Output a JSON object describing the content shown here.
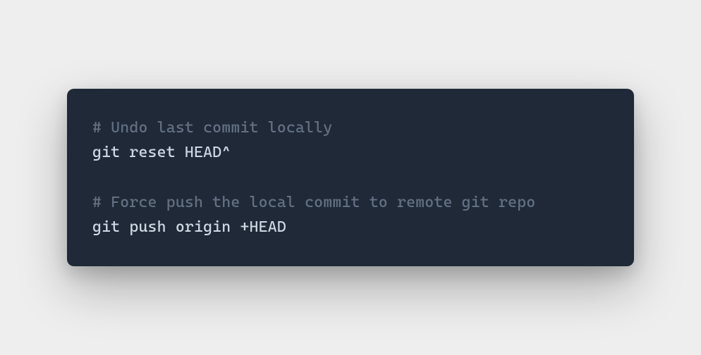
{
  "code": {
    "comment1": "# Undo last commit locally",
    "command1": "git reset HEAD^",
    "comment2": "# Force push the local commit to remote git repo",
    "command2": "git push origin +HEAD"
  }
}
